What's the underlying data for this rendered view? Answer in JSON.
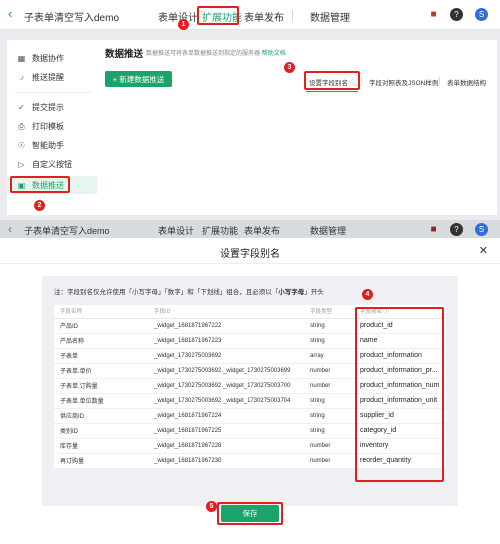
{
  "header": {
    "back_icon": "chevron-left-icon",
    "app_title": "子表单清空写入demo",
    "tabs": [
      {
        "label": "表单设计"
      },
      {
        "label": "扩展功能"
      },
      {
        "label": "表单发布"
      },
      {
        "label": "数据管理"
      }
    ],
    "icons": [
      "gift-icon",
      "help-icon",
      "avatar"
    ],
    "help_badge": "?",
    "avatar_letter": "S"
  },
  "annotations": [
    "1",
    "2",
    "3",
    "4",
    "5"
  ],
  "sidebar": {
    "items": [
      {
        "label": "数据协作",
        "icon": "grid-icon"
      },
      {
        "label": "推送提醒",
        "icon": "bell-icon"
      },
      {
        "label": "提交提示",
        "icon": "check-circle-icon"
      },
      {
        "label": "打印模板",
        "icon": "printer-icon"
      },
      {
        "label": "智能助手",
        "icon": "bulb-icon"
      },
      {
        "label": "自定义按钮",
        "icon": "cursor-icon"
      },
      {
        "label": "数据推送",
        "icon": "push-icon"
      }
    ]
  },
  "main": {
    "title": "数据推送",
    "description": "数据推送可将表单数据推送到指定的服务器",
    "help_link": "帮助文档",
    "new_button": "+ 新建数据推送",
    "tabs": [
      {
        "label": "设置字段别名"
      },
      {
        "label": "字段对照表及JSON样例"
      },
      {
        "label": "表单数据结构"
      }
    ]
  },
  "modal": {
    "title": "设置字段别名",
    "close_icon": "close-icon",
    "note_parts": [
      "注：字段别名仅允许使用「小写字母」「数字」和「下划线」组合，且必须以「",
      "小写字母",
      "」开头"
    ],
    "columns": [
      "字段名称",
      "字段ID",
      "字段类型",
      "字段别名"
    ],
    "rows": [
      {
        "name": "产品ID",
        "id": "_widget_1681871967222",
        "type": "string",
        "alias": "product_id"
      },
      {
        "name": "产品名称",
        "id": "_widget_1681871967223",
        "type": "string",
        "alias": "name"
      },
      {
        "name": "子表单",
        "id": "_widget_1730275003692",
        "type": "array",
        "alias": "product_information"
      },
      {
        "name": "子表单.单价",
        "id": "_widget_1730275003692._widget_1730275003699",
        "type": "number",
        "alias": "product_information_pr..."
      },
      {
        "name": "子表单.订购量",
        "id": "_widget_1730275003692._widget_1730275003700",
        "type": "number",
        "alias": "product_information_num"
      },
      {
        "name": "子表单.单位数量",
        "id": "_widget_1730275003692._widget_1730275003704",
        "type": "string",
        "alias": "product_information_unit"
      },
      {
        "name": "供应商ID",
        "id": "_widget_1681871967224",
        "type": "string",
        "alias": "supplier_id"
      },
      {
        "name": "类别ID",
        "id": "_widget_1681871967225",
        "type": "string",
        "alias": "category_id"
      },
      {
        "name": "库存量",
        "id": "_widget_1681871967228",
        "type": "number",
        "alias": "inventory"
      },
      {
        "name": "再订购量",
        "id": "_widget_1681871967230",
        "type": "number",
        "alias": "reorder_quantity"
      }
    ],
    "save_button": "保存"
  }
}
